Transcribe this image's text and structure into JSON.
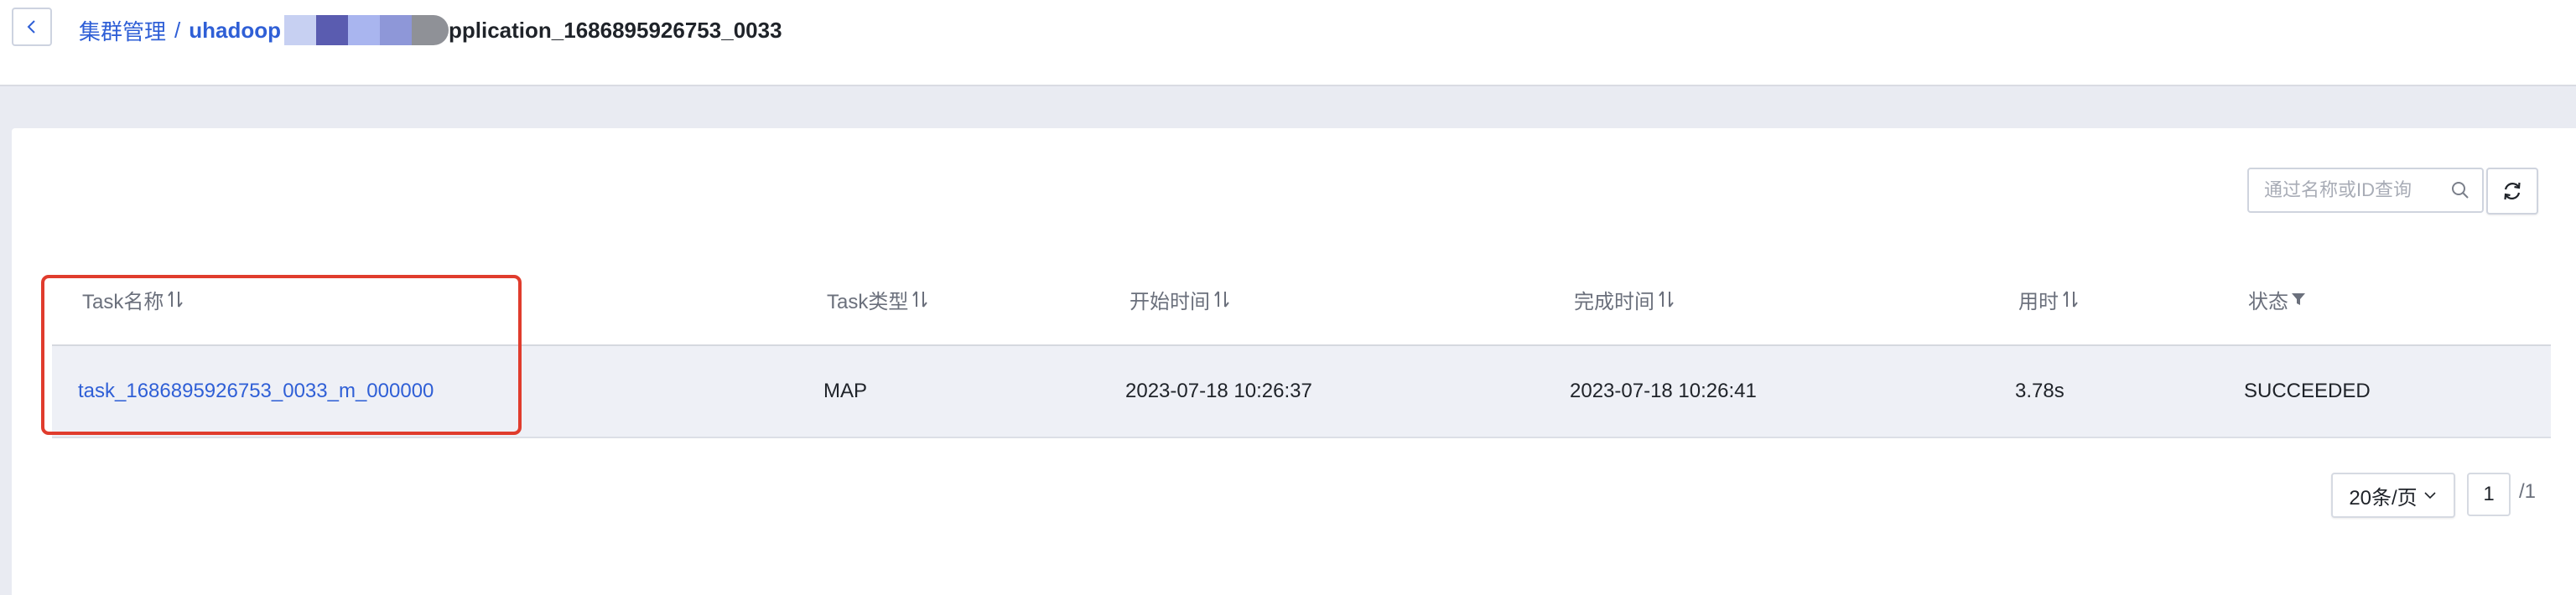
{
  "header": {
    "back_icon": "chevron-left-icon",
    "breadcrumb": {
      "root": "集群管理",
      "separator": "/",
      "cluster": "uhadoop",
      "current": "pplication_1686895926753_0033"
    },
    "redaction_colors": [
      "#c7d0f2",
      "#5a5cb0",
      "#a9b5ef",
      "#8e97d8",
      "#8f9197"
    ]
  },
  "toolbar": {
    "search_placeholder": "通过名称或ID查询",
    "search_icon": "search-icon",
    "refresh_icon": "refresh-icon"
  },
  "table": {
    "columns": [
      {
        "label": "Task名称",
        "sortable": true
      },
      {
        "label": "Task类型",
        "sortable": true
      },
      {
        "label": "开始时间",
        "sortable": true
      },
      {
        "label": "完成时间",
        "sortable": true
      },
      {
        "label": "用时",
        "sortable": true
      },
      {
        "label": "状态",
        "filterable": true
      }
    ],
    "rows": [
      {
        "name": "task_1686895926753_0033_m_000000",
        "type": "MAP",
        "start": "2023-07-18 10:26:37",
        "finish": "2023-07-18 10:26:41",
        "duration": "3.78s",
        "status": "SUCCEEDED"
      }
    ]
  },
  "pagination": {
    "page_size": "20条/页",
    "current_page": "1",
    "total": "/1"
  },
  "colors": {
    "accent": "#2f5fd6",
    "highlight_border": "#e03c2d",
    "page_background": "#e9ebf2",
    "row_background": "#eef0f6"
  }
}
